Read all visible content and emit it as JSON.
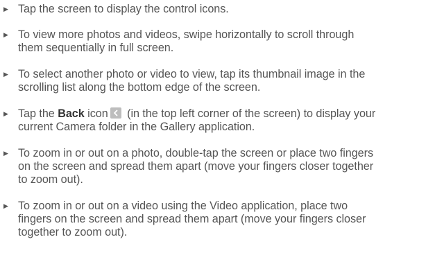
{
  "bullet_glyph": "▶",
  "items": [
    {
      "lines": [
        "Tap the screen to display the control icons."
      ]
    },
    {
      "lines": [
        "To view more photos and videos, swipe horizontally to scroll through",
        "them sequentially in full screen."
      ]
    },
    {
      "lines": [
        "To select another photo or video to view, tap its thumbnail image in the",
        "scrolling list along the bottom edge of the screen."
      ]
    },
    {
      "line1_before": "Tap the ",
      "line1_bold": "Back",
      "line1_icon": "chevron-left-icon",
      "line1_after": " (in the top left corner of the screen) to display your",
      "line1_middle": " icon",
      "line2": "current Camera folder in the Gallery application."
    },
    {
      "lines": [
        "To zoom in or out on a photo, double-tap the screen or place two fingers",
        "on the screen and spread them apart (move your fingers closer together",
        "to zoom out)."
      ]
    },
    {
      "lines": [
        "To zoom in or out on a video using the Video application, place two",
        "fingers on the screen and spread them apart (move your fingers closer",
        "together to zoom out)."
      ]
    }
  ],
  "colors": {
    "text": "#555555",
    "bold_text": "#333333",
    "icon_bg": "#bdbdbd",
    "icon_fg": "#ffffff"
  }
}
